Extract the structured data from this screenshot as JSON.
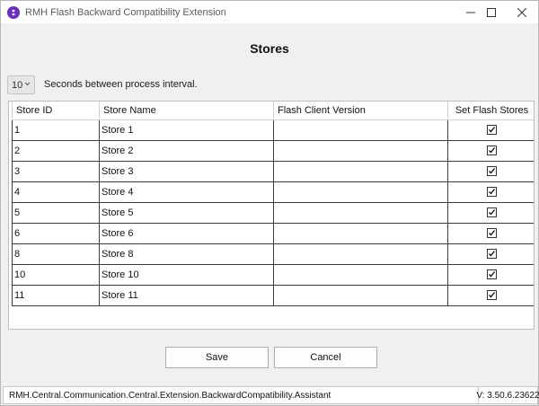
{
  "window": {
    "title": "RMH Flash Backward Compatibility Extension",
    "icon": "app-logo-icon"
  },
  "page": {
    "heading": "Stores"
  },
  "interval": {
    "value": "10",
    "label": "Seconds between process interval."
  },
  "grid": {
    "columns": [
      "Store ID",
      "Store Name",
      "Flash Client Version",
      "Set Flash Stores"
    ],
    "rows": [
      {
        "id": "1",
        "name": "Store 1",
        "version": "",
        "checked": true
      },
      {
        "id": "2",
        "name": "Store 2",
        "version": "",
        "checked": true
      },
      {
        "id": "3",
        "name": "Store 3",
        "version": "",
        "checked": true
      },
      {
        "id": "4",
        "name": "Store 4",
        "version": "",
        "checked": true
      },
      {
        "id": "5",
        "name": "Store 5",
        "version": "",
        "checked": true
      },
      {
        "id": "6",
        "name": "Store 6",
        "version": "",
        "checked": true
      },
      {
        "id": "8",
        "name": "Store 8",
        "version": "",
        "checked": true
      },
      {
        "id": "10",
        "name": "Store 10",
        "version": "",
        "checked": true
      },
      {
        "id": "11",
        "name": "Store 11",
        "version": "",
        "checked": true
      }
    ]
  },
  "buttons": {
    "save": "Save",
    "cancel": "Cancel"
  },
  "status": {
    "assembly": "RMH.Central.Communication.Central.Extension.BackwardCompatibility.Assistant",
    "version": "V: 3.50.6.23622"
  },
  "colors": {
    "app_icon": "#6b2fbf",
    "grid_line": "#3c3c3c",
    "window_bg": "#f0f0f0"
  }
}
